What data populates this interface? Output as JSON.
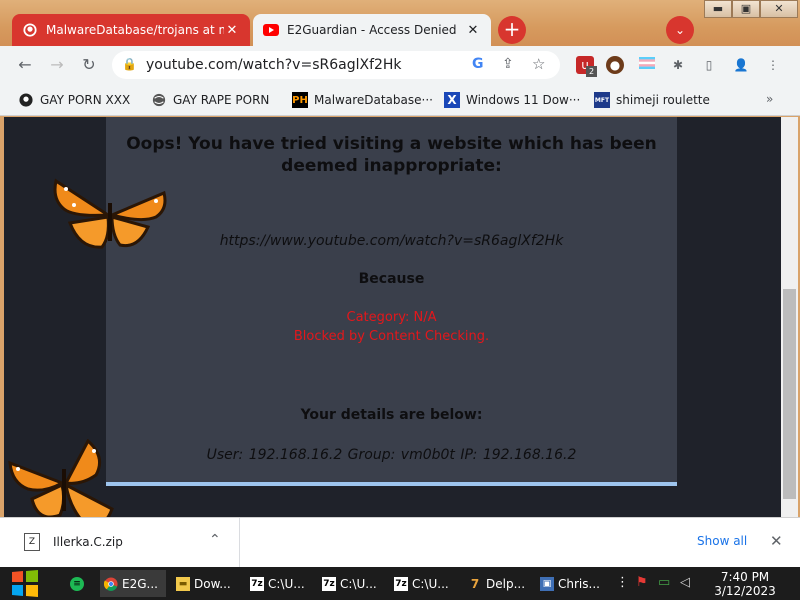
{
  "browser": {
    "tabs": [
      {
        "title": "MalwareDatabase/trojans at m",
        "icon": "github-icon",
        "active": false
      },
      {
        "title": "E2Guardian - Access Denied",
        "icon": "youtube-icon",
        "active": true
      }
    ],
    "new_tab_label": "+",
    "address": "youtube.com/watch?v=sR6aglXf2Hk",
    "bookmarks": [
      {
        "label": "GAY PORN XXX",
        "icon": "github-icon"
      },
      {
        "label": "GAY RAPE PORN",
        "icon": "globe-icon"
      },
      {
        "label": "MalwareDatabase···",
        "icon": "pornhub-icon",
        "badge": "PH"
      },
      {
        "label": "Windows 11 Dow···",
        "icon": "x-icon"
      },
      {
        "label": "shimeji roulette",
        "icon": "mft-icon",
        "badge": "MFT"
      }
    ],
    "bookmarks_overflow": "»",
    "extension_badge": "2"
  },
  "block_page": {
    "heading": "Oops! You have tried visiting a website which has been deemed inappropriate:",
    "url": "https://www.youtube.com/watch?v=sR6aglXf2Hk",
    "because": "Because",
    "category": "Category: N/A",
    "reason": "Blocked by Content Checking.",
    "details_heading": "Your details are below:",
    "user_line": "User: 192.168.16.2   Group: vm0b0t   IP: 192.168.16.2",
    "colors": {
      "page_bg": "#3a3f4b",
      "alert": "#e4171b",
      "accent_border": "#9ec5ee"
    }
  },
  "downloads": {
    "file": "Illerka.C.zip",
    "show_all": "Show all"
  },
  "taskbar": {
    "items": [
      {
        "label": "",
        "icon": "spotify-icon"
      },
      {
        "label": "E2G...",
        "icon": "chrome-icon"
      },
      {
        "label": "Dow...",
        "icon": "folder-icon"
      },
      {
        "label": "C:\\U...",
        "icon": "7zip-icon"
      },
      {
        "label": "C:\\U...",
        "icon": "7zip-icon"
      },
      {
        "label": "C:\\U...",
        "icon": "7zip-icon"
      },
      {
        "label": "Delp...",
        "icon": "delphi-icon"
      },
      {
        "label": "Chris...",
        "icon": "app-icon"
      }
    ],
    "time": "7:40 PM",
    "date": "3/12/2023"
  }
}
